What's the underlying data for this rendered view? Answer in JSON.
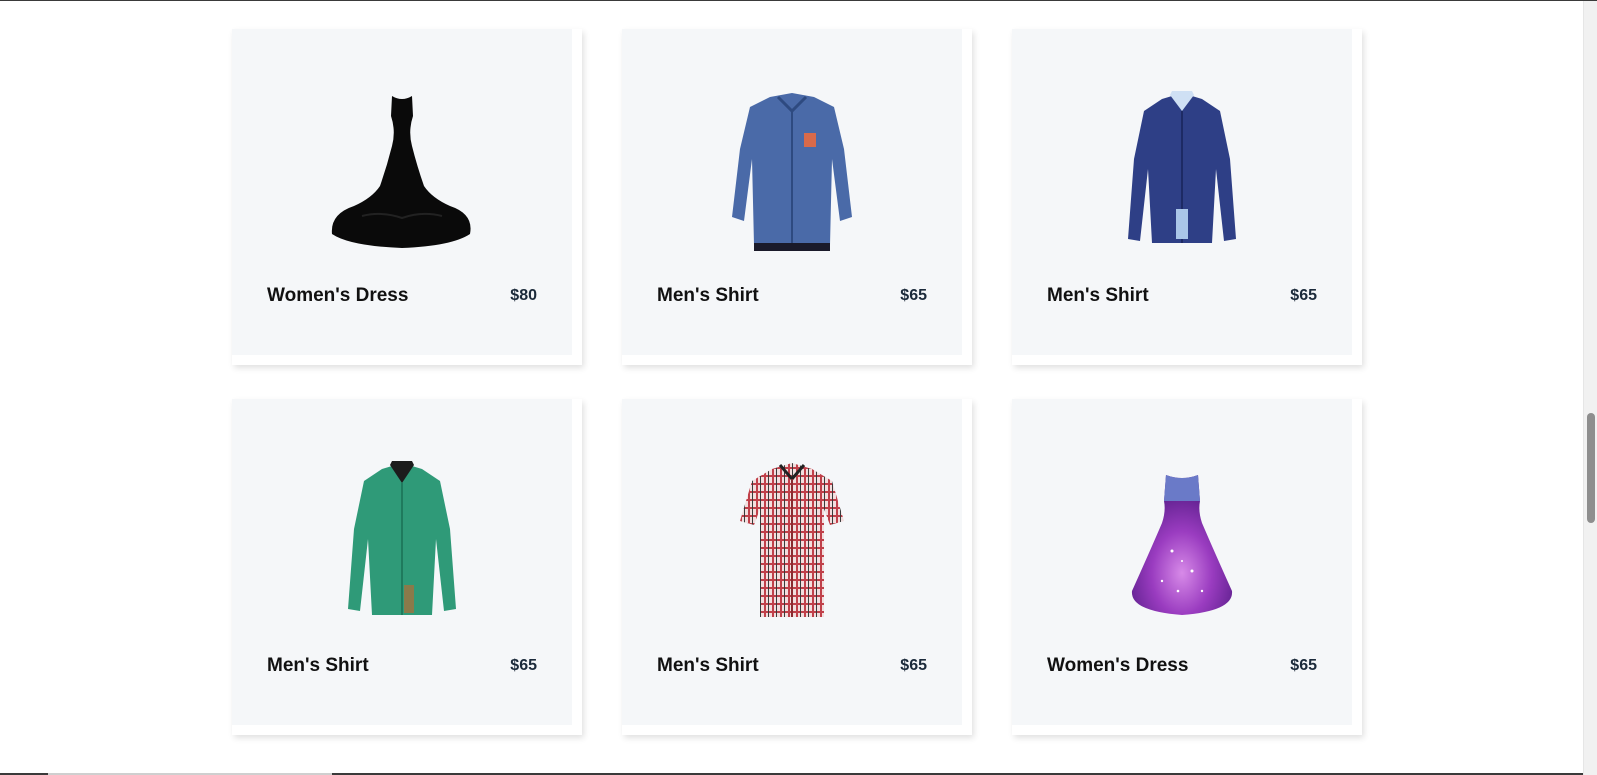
{
  "products": [
    {
      "name": "Women's Dress",
      "price": "$80",
      "image_icon": "black-dress-icon"
    },
    {
      "name": "Men's Shirt",
      "price": "$65",
      "image_icon": "blue-denim-shirt-icon"
    },
    {
      "name": "Men's Shirt",
      "price": "$65",
      "image_icon": "navy-shirt-icon"
    },
    {
      "name": "Men's Shirt",
      "price": "$65",
      "image_icon": "green-shirt-icon"
    },
    {
      "name": "Men's Shirt",
      "price": "$65",
      "image_icon": "plaid-shirt-icon"
    },
    {
      "name": "Women's Dress",
      "price": "$65",
      "image_icon": "purple-galaxy-dress-icon"
    }
  ],
  "colors": {
    "card_bg": "#f5f7f9",
    "name_text": "#111111",
    "price_text": "#1b2a3a"
  }
}
